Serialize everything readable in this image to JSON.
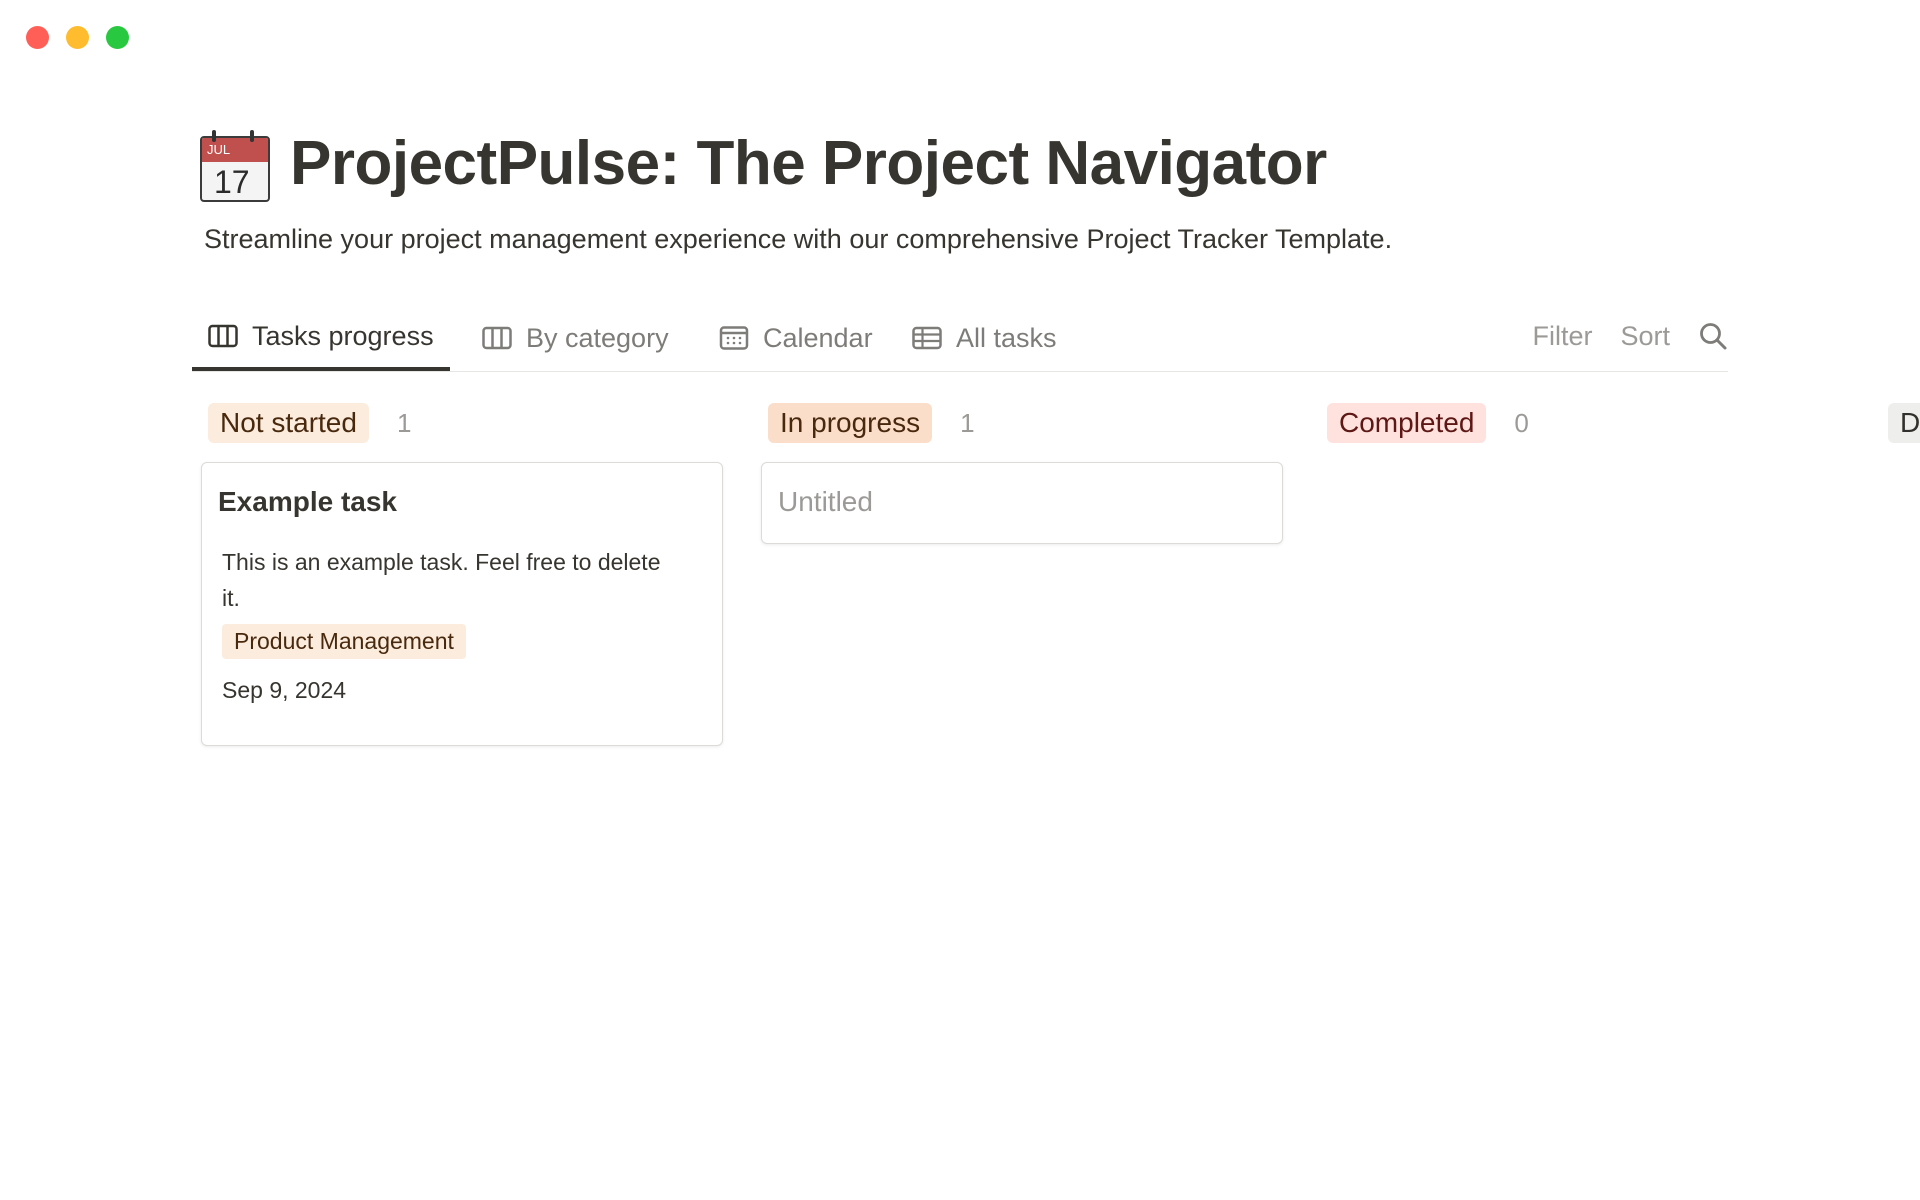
{
  "header": {
    "icon_month": "JUL",
    "icon_day": "17",
    "title": "ProjectPulse: The Project Navigator",
    "subtitle": "Streamline your project management experience with our comprehensive Project Tracker Template."
  },
  "tabs": [
    {
      "label": "Tasks progress",
      "icon": "board-icon",
      "active": true
    },
    {
      "label": "By category",
      "icon": "board-icon",
      "active": false
    },
    {
      "label": "Calendar",
      "icon": "calendar-icon",
      "active": false
    },
    {
      "label": "All tasks",
      "icon": "table-icon",
      "active": false
    }
  ],
  "toolbar": {
    "filter_label": "Filter",
    "sort_label": "Sort",
    "search_icon": "search-icon"
  },
  "columns": [
    {
      "label": "Not started",
      "count": "1",
      "color": "#fbecdd",
      "cards": [
        {
          "title": "Example task",
          "description": "This is an example task. Feel free to delete it.",
          "tag": "Product Management",
          "date": "Sep 9, 2024"
        }
      ]
    },
    {
      "label": "In progress",
      "count": "1",
      "color": "#fadec9",
      "cards": [
        {
          "title": "Untitled"
        }
      ]
    },
    {
      "label": "Completed",
      "count": "0",
      "color": "#ffe2dd",
      "cards": []
    },
    {
      "label": "D",
      "color": "#eeeeec"
    }
  ]
}
